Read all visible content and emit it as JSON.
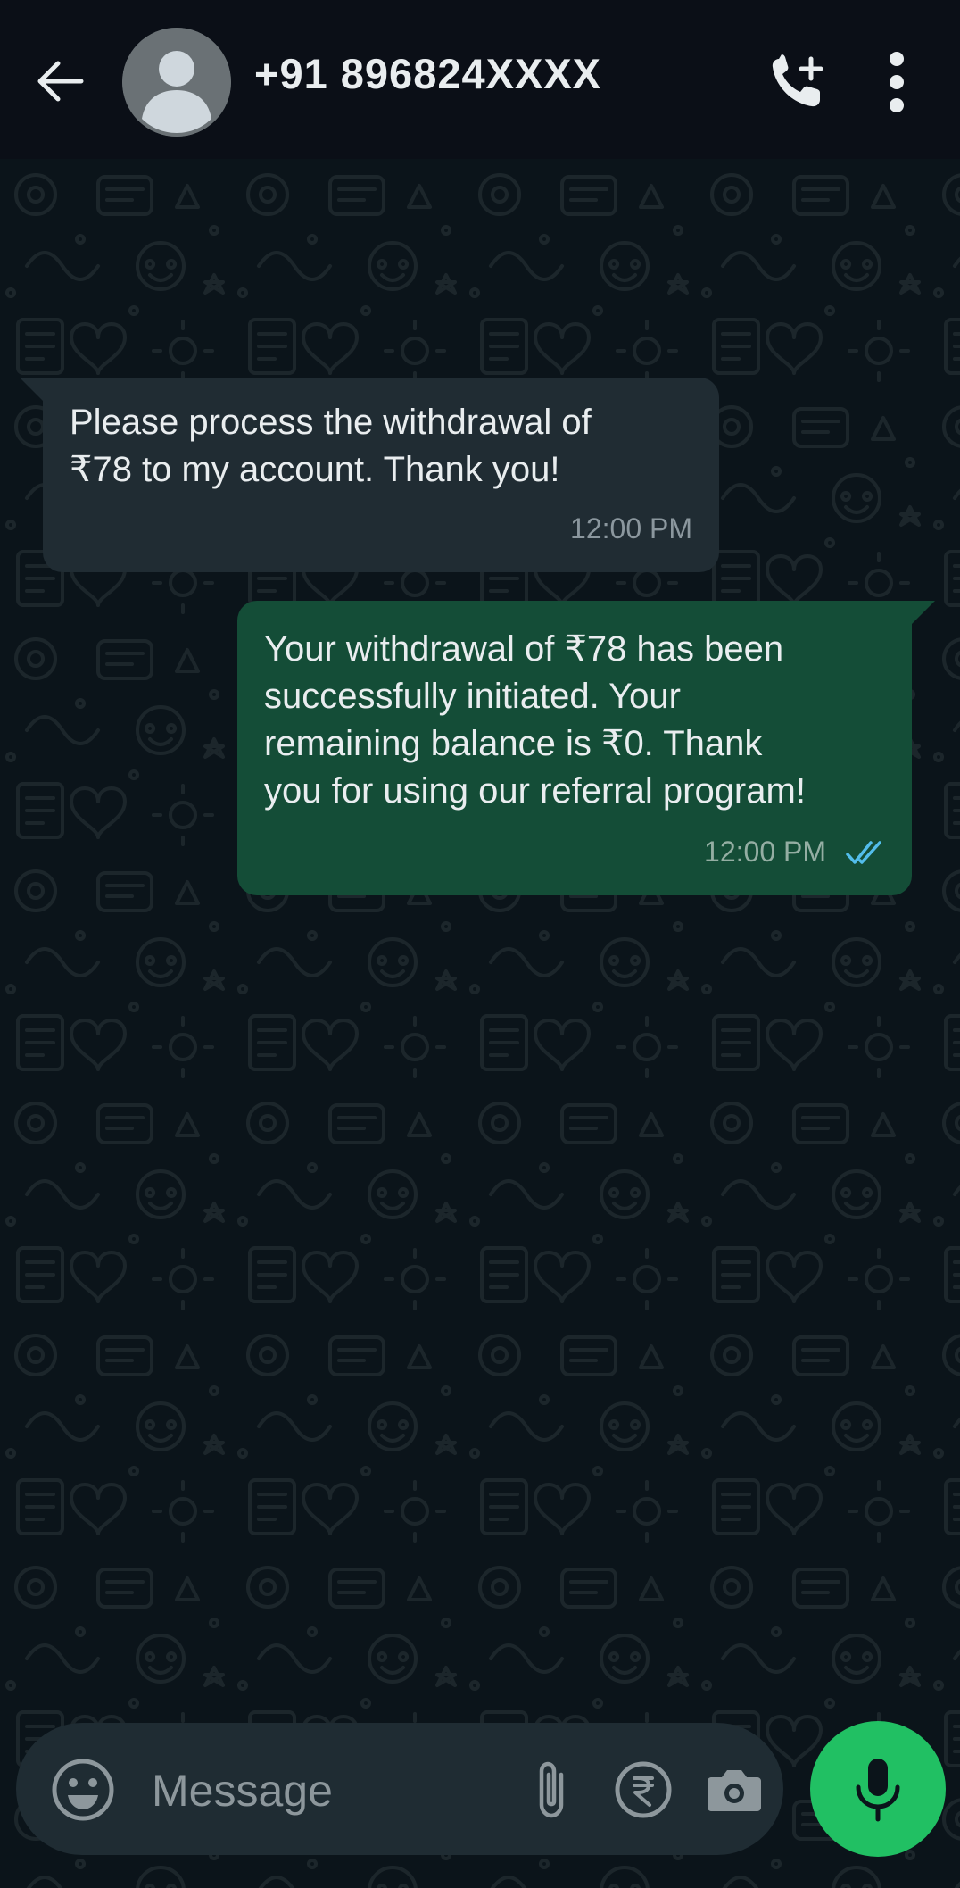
{
  "header": {
    "contact_name": "+91 896824XXXX",
    "back_icon": "arrow-left-icon",
    "avatar_icon": "default-person-avatar",
    "call_icon": "add-call-icon",
    "menu_icon": "vertical-dots-icon"
  },
  "messages": [
    {
      "direction": "incoming",
      "text": "Please process the withdrawal of\n₹78 to my account. Thank you!",
      "time": "12:00 PM"
    },
    {
      "direction": "outgoing",
      "text": "Your withdrawal of ₹78 has been\nsuccessfully initiated. Your\nremaining balance is ₹0. Thank\nyou for using our referral program!",
      "time": "12:00 PM",
      "status_icon": "double-check-read-icon"
    }
  ],
  "composer": {
    "placeholder": "Message",
    "emoji_icon": "smiley-icon",
    "attach_icon": "paperclip-icon",
    "payment_icon": "rupee-icon",
    "camera_icon": "camera-icon",
    "mic_icon": "microphone-icon"
  },
  "colors": {
    "header_bg": "#0b0f17",
    "chat_bg": "#0b141a",
    "incoming_bubble": "#202c33",
    "outgoing_bubble": "#144d37",
    "read_ticks": "#53bdeb",
    "mic_button": "#21c063"
  }
}
